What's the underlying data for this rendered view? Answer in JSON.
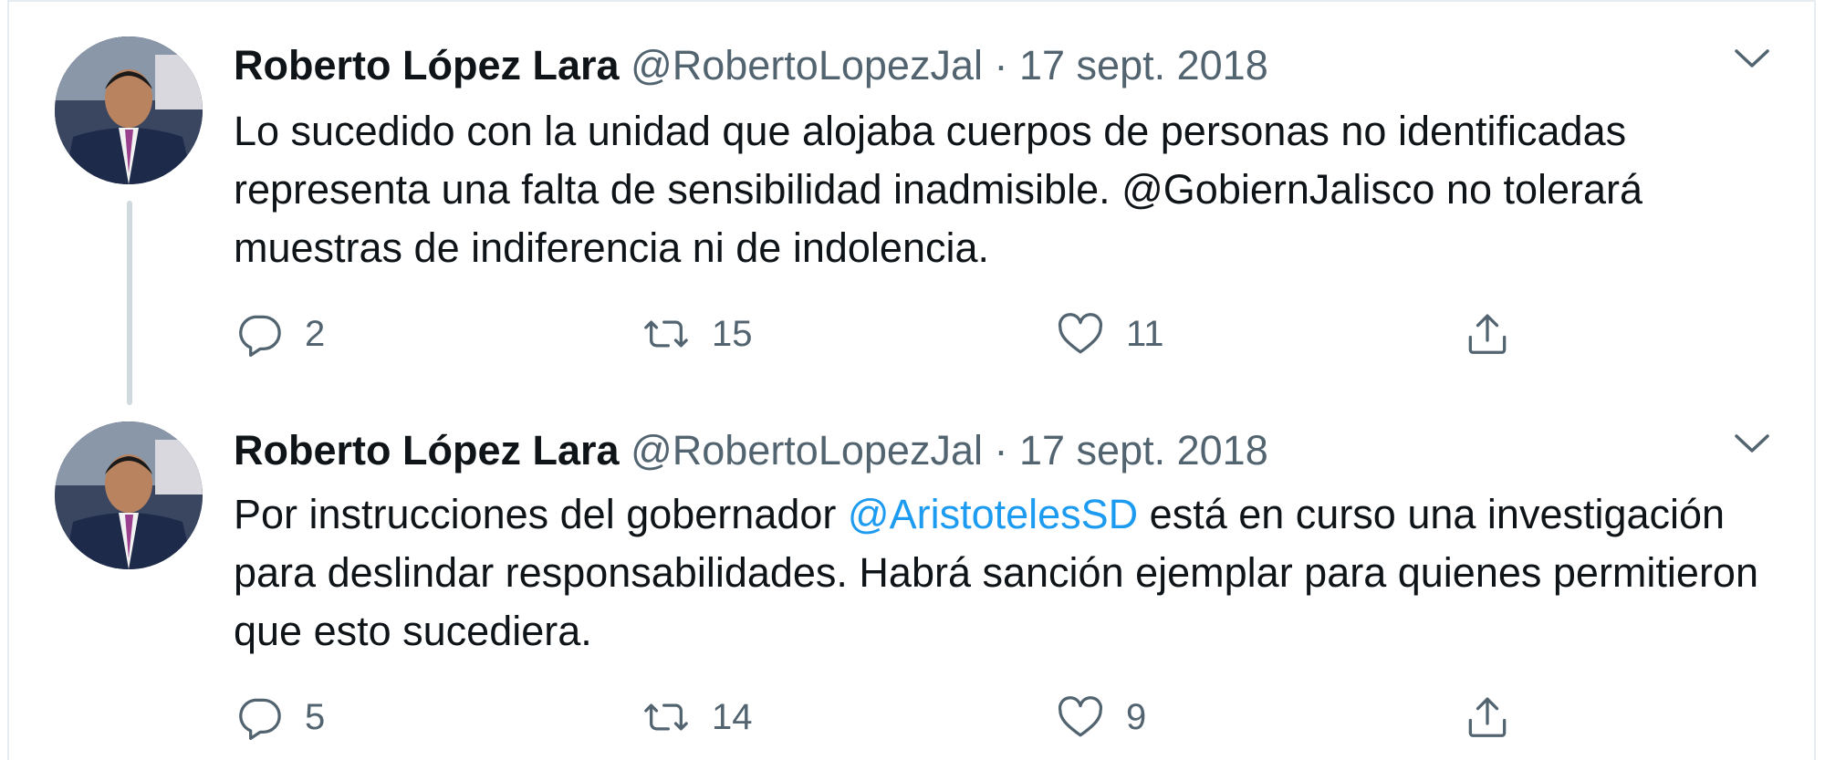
{
  "tweets": [
    {
      "author_name": "Roberto López Lara",
      "handle": "@RobertoLopezJal",
      "separator": "·",
      "date": "17 sept. 2018",
      "text_parts": [
        {
          "text": "Lo sucedido con la unidad que alojaba cuerpos de personas no identificadas representa una falta de sensibilidad inadmisible. @GobiernJalisco no tolerará muestras de indiferencia ni de indolencia.",
          "mention": false
        }
      ],
      "replies": "2",
      "retweets": "15",
      "likes": "11"
    },
    {
      "author_name": "Roberto López Lara",
      "handle": "@RobertoLopezJal",
      "separator": "·",
      "date": "17 sept. 2018",
      "text_parts": [
        {
          "text": "Por instrucciones del gobernador ",
          "mention": false
        },
        {
          "text": "@AristotelesSD",
          "mention": true
        },
        {
          "text": " está en curso una investigación para deslindar responsabilidades. Habrá sanción ejemplar para quienes permitieron que esto sucediera.",
          "mention": false
        }
      ],
      "replies": "5",
      "retweets": "14",
      "likes": "9"
    }
  ],
  "colors": {
    "mention": "#1d9bf0",
    "muted": "#536471",
    "text": "#0f1419",
    "thread_line": "#cfd9de"
  },
  "icons": [
    "reply-icon",
    "retweet-icon",
    "like-icon",
    "share-icon",
    "chevron-down-icon"
  ]
}
